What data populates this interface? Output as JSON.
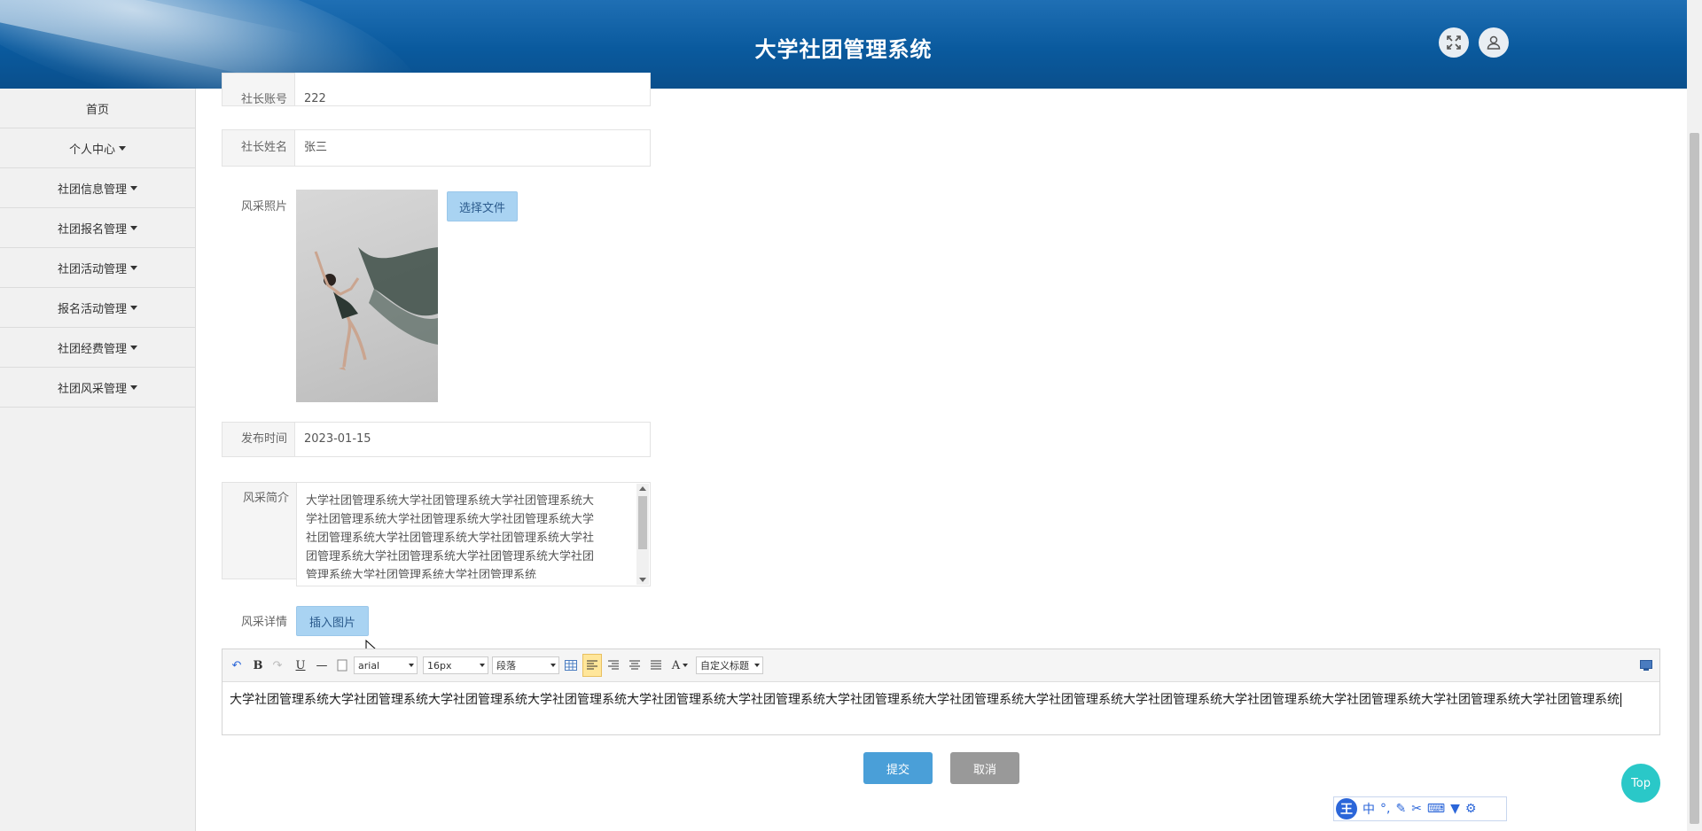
{
  "header": {
    "title": "大学社团管理系统"
  },
  "sidebar": {
    "items": [
      {
        "label": "首页",
        "has_caret": false
      },
      {
        "label": "个人中心",
        "has_caret": true
      },
      {
        "label": "社团信息管理",
        "has_caret": true
      },
      {
        "label": "社团报名管理",
        "has_caret": true
      },
      {
        "label": "社团活动管理",
        "has_caret": true
      },
      {
        "label": "报名活动管理",
        "has_caret": true
      },
      {
        "label": "社团经费管理",
        "has_caret": true
      },
      {
        "label": "社团风采管理",
        "has_caret": true
      }
    ]
  },
  "form": {
    "account": {
      "label": "社长账号",
      "value": "222"
    },
    "name": {
      "label": "社长姓名",
      "value": "张三"
    },
    "photo": {
      "label": "风采照片",
      "button": "选择文件"
    },
    "date": {
      "label": "发布时间",
      "value": "2023-01-15"
    },
    "intro": {
      "label": "风采简介",
      "value": "大学社团管理系统大学社团管理系统大学社团管理系统大学社团管理系统大学社团管理系统大学社团管理系统大学社团管理系统大学社团管理系统大学社团管理系统大学社团管理系统大学社团管理系统大学社团管理系统大学社团管理系统大学社团管理系统大学社团管理系统"
    },
    "detail": {
      "label": "风采详情",
      "button": "插入图片"
    }
  },
  "editor": {
    "font_family": "arial",
    "font_size": "16px",
    "paragraph": "段落",
    "custom_title": "自定义标题",
    "bold": "B",
    "underline": "U",
    "color": "A",
    "content": "大学社团管理系统大学社团管理系统大学社团管理系统大学社团管理系统大学社团管理系统大学社团管理系统大学社团管理系统大学社团管理系统大学社团管理系统大学社团管理系统大学社团管理系统大学社团管理系统大学社团管理系统大学社团管理系统"
  },
  "actions": {
    "submit": "提交",
    "cancel": "取消"
  },
  "back_to_top": "Top",
  "ime": {
    "logo": "王",
    "mode": "中",
    "punct": "°,"
  }
}
